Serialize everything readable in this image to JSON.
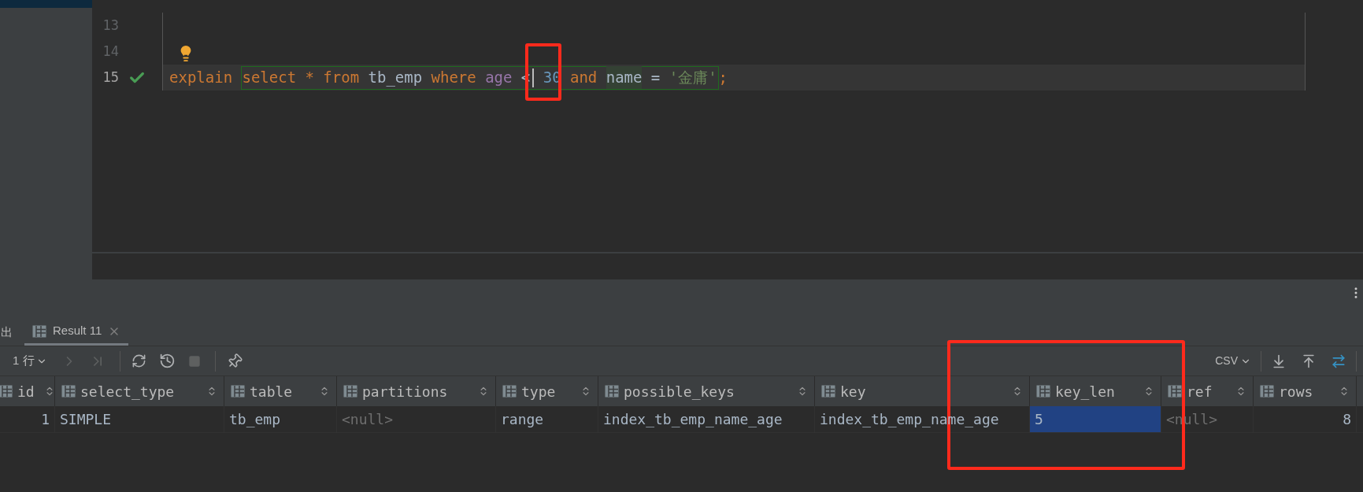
{
  "editor": {
    "lines": [
      {
        "number": "13",
        "current": false,
        "check": false,
        "bulb": false
      },
      {
        "number": "14",
        "current": false,
        "check": false,
        "bulb": true
      },
      {
        "number": "15",
        "current": true,
        "check": true,
        "bulb": false,
        "lead": [
          {
            "text": "explain",
            "kind": "keyword",
            "cursor": false
          }
        ],
        "statement": [
          {
            "text": "select",
            "kind": "keyword",
            "cursor": false
          },
          {
            "text": "*",
            "kind": "keyword",
            "cursor": false
          },
          {
            "text": "from",
            "kind": "keyword",
            "cursor": false
          },
          {
            "text": "tb_emp",
            "kind": "ident",
            "cursor": false
          },
          {
            "text": "where",
            "kind": "keyword",
            "cursor": false
          },
          {
            "text": "age",
            "kind": "column",
            "cursor": false
          },
          {
            "text": "<",
            "kind": "op",
            "cursor": true
          },
          {
            "text": "30",
            "kind": "number",
            "cursor": false
          },
          {
            "text": "and",
            "kind": "keyword",
            "cursor": false
          },
          {
            "text": "name",
            "kind": "marked",
            "cursor": false
          },
          {
            "text": "=",
            "kind": "op",
            "cursor": false
          },
          {
            "text": "'金庸'",
            "kind": "string",
            "cursor": false
          }
        ],
        "trail": [
          {
            "text": ";",
            "kind": "keyword",
            "cursor": false
          }
        ]
      }
    ]
  },
  "results": {
    "side_tab": "出",
    "tab": {
      "label": "Result 11",
      "selected": true
    },
    "toolbar": {
      "page_size": "1 行",
      "format": "CSV"
    },
    "columns": [
      "id",
      "select_type",
      "table",
      "partitions",
      "type",
      "possible_keys",
      "key",
      "key_len",
      "ref",
      "rows"
    ],
    "rows": [
      [
        {
          "text": "1",
          "kind": "number",
          "selected": false
        },
        {
          "text": "SIMPLE",
          "kind": "text",
          "selected": false
        },
        {
          "text": "tb_emp",
          "kind": "text",
          "selected": false
        },
        {
          "text": "<null>",
          "kind": "null",
          "selected": false
        },
        {
          "text": "range",
          "kind": "text",
          "selected": false
        },
        {
          "text": "index_tb_emp_name_age",
          "kind": "text",
          "selected": false
        },
        {
          "text": "index_tb_emp_name_age",
          "kind": "text",
          "selected": false
        },
        {
          "text": "5",
          "kind": "text",
          "selected": true
        },
        {
          "text": "<null>",
          "kind": "null",
          "selected": false
        },
        {
          "text": "8",
          "kind": "number",
          "selected": false
        }
      ]
    ]
  }
}
